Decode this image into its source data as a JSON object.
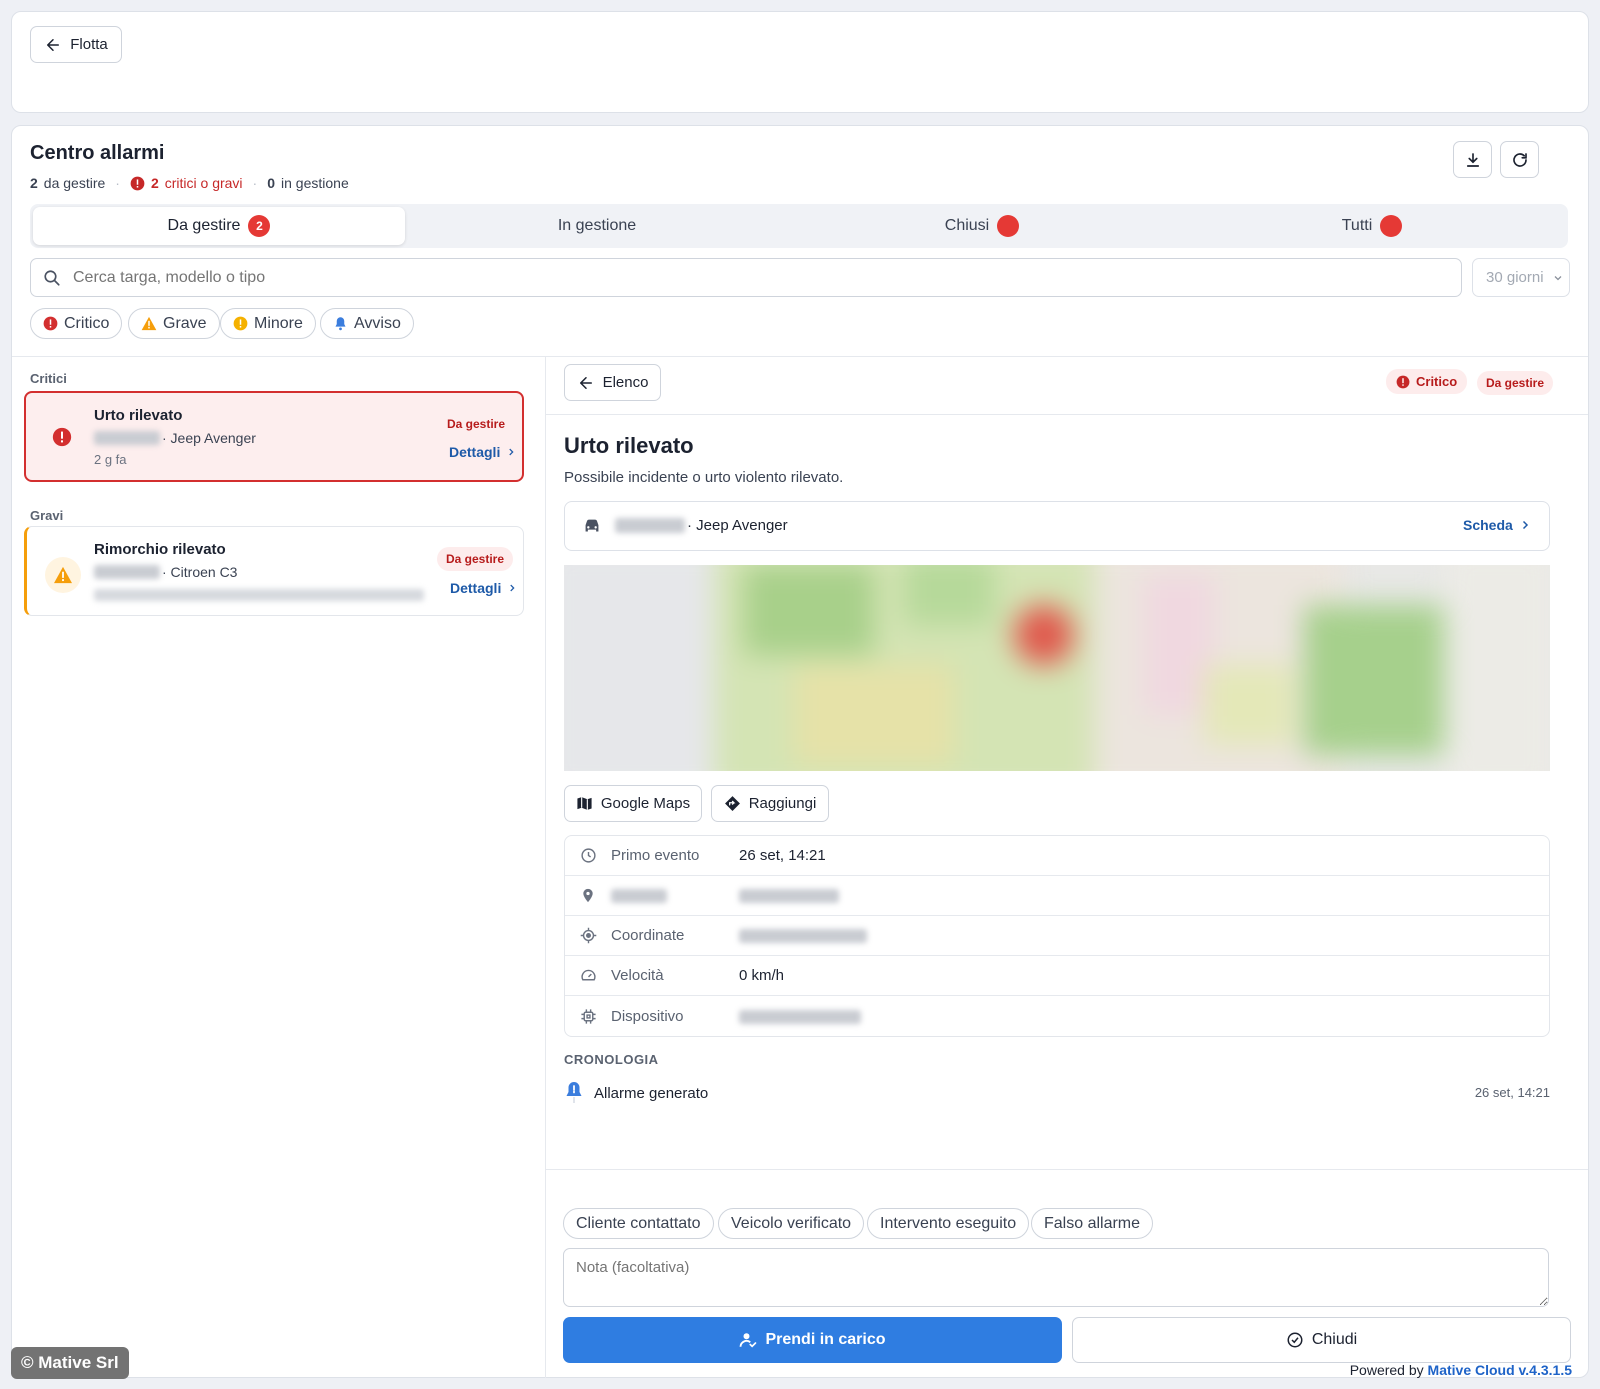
{
  "topbar": {
    "back_label": "Flotta"
  },
  "header": {
    "title": "Centro allarmi",
    "stats": [
      {
        "count": "2",
        "label": "da gestire"
      },
      {
        "count": "2",
        "label": "critici o gravi"
      },
      {
        "count": "0",
        "label": "in gestione"
      }
    ]
  },
  "tabs": [
    {
      "label": "Da gestire",
      "badge": "2"
    },
    {
      "label": "In gestione"
    },
    {
      "label": "Chiusi"
    },
    {
      "label": "Tutti"
    }
  ],
  "search": {
    "placeholder": "Cerca targa, modello o tipo",
    "period": "30 giorni"
  },
  "filters": [
    {
      "label": "Critico",
      "icon": "exclamation-circle-icon",
      "color": "#d32f2f"
    },
    {
      "label": "Grave",
      "icon": "warning-triangle-icon",
      "color": "#f59e0b"
    },
    {
      "label": "Minore",
      "icon": "exclamation-circle-icon",
      "color": "#f5b100"
    },
    {
      "label": "Avviso",
      "icon": "bell-icon",
      "color": "#3b7ddd"
    }
  ],
  "list": {
    "groups": [
      {
        "title": "Critici",
        "items": [
          {
            "title": "Urto rilevato",
            "vehicle": "· Jeep Avenger",
            "time": "2 g fa",
            "status": "Da gestire",
            "link": "Dettagli"
          }
        ]
      },
      {
        "title": "Gravi",
        "items": [
          {
            "title": "Rimorchio rilevato",
            "vehicle": "· Citroen C3",
            "status": "Da gestire",
            "link": "Dettagli"
          }
        ]
      }
    ]
  },
  "detail": {
    "back_label": "Elenco",
    "severity": "Critico",
    "status": "Da gestire",
    "title": "Urto rilevato",
    "description": "Possibile incidente o urto violento rilevato.",
    "vehicle": "· Jeep Avenger",
    "vehicle_link": "Scheda",
    "map_actions": [
      "Google Maps",
      "Raggiungi"
    ],
    "info": [
      {
        "icon": "clock-icon",
        "label": "Primo evento",
        "value": "26 set, 14:21"
      },
      {
        "icon": "pin-icon",
        "label": "",
        "value": ""
      },
      {
        "icon": "target-icon",
        "label": "Coordinate",
        "value": ""
      },
      {
        "icon": "speedometer-icon",
        "label": "Velocità",
        "value": "0 km/h"
      },
      {
        "icon": "chip-icon",
        "label": "Dispositivo",
        "value": ""
      }
    ],
    "timeline_title": "CRONOLOGIA",
    "timeline": [
      {
        "label": "Allarme generato",
        "time": "26 set, 14:21"
      }
    ],
    "quick_actions": [
      "Cliente contattato",
      "Veicolo verificato",
      "Intervento eseguito",
      "Falso allarme"
    ],
    "note_placeholder": "Nota (facoltativa)",
    "primary_action": "Prendi in carico",
    "secondary_action": "Chiudi"
  },
  "footer": {
    "copyright": "© Mative Srl",
    "powered_prefix": "Powered by",
    "powered_brand": "Mative Cloud v.4.3.1.5"
  },
  "colors": {
    "accent": "#2f7de1",
    "critical": "#d32f2f",
    "warning": "#f59e0b",
    "link": "#1e5aa8"
  }
}
